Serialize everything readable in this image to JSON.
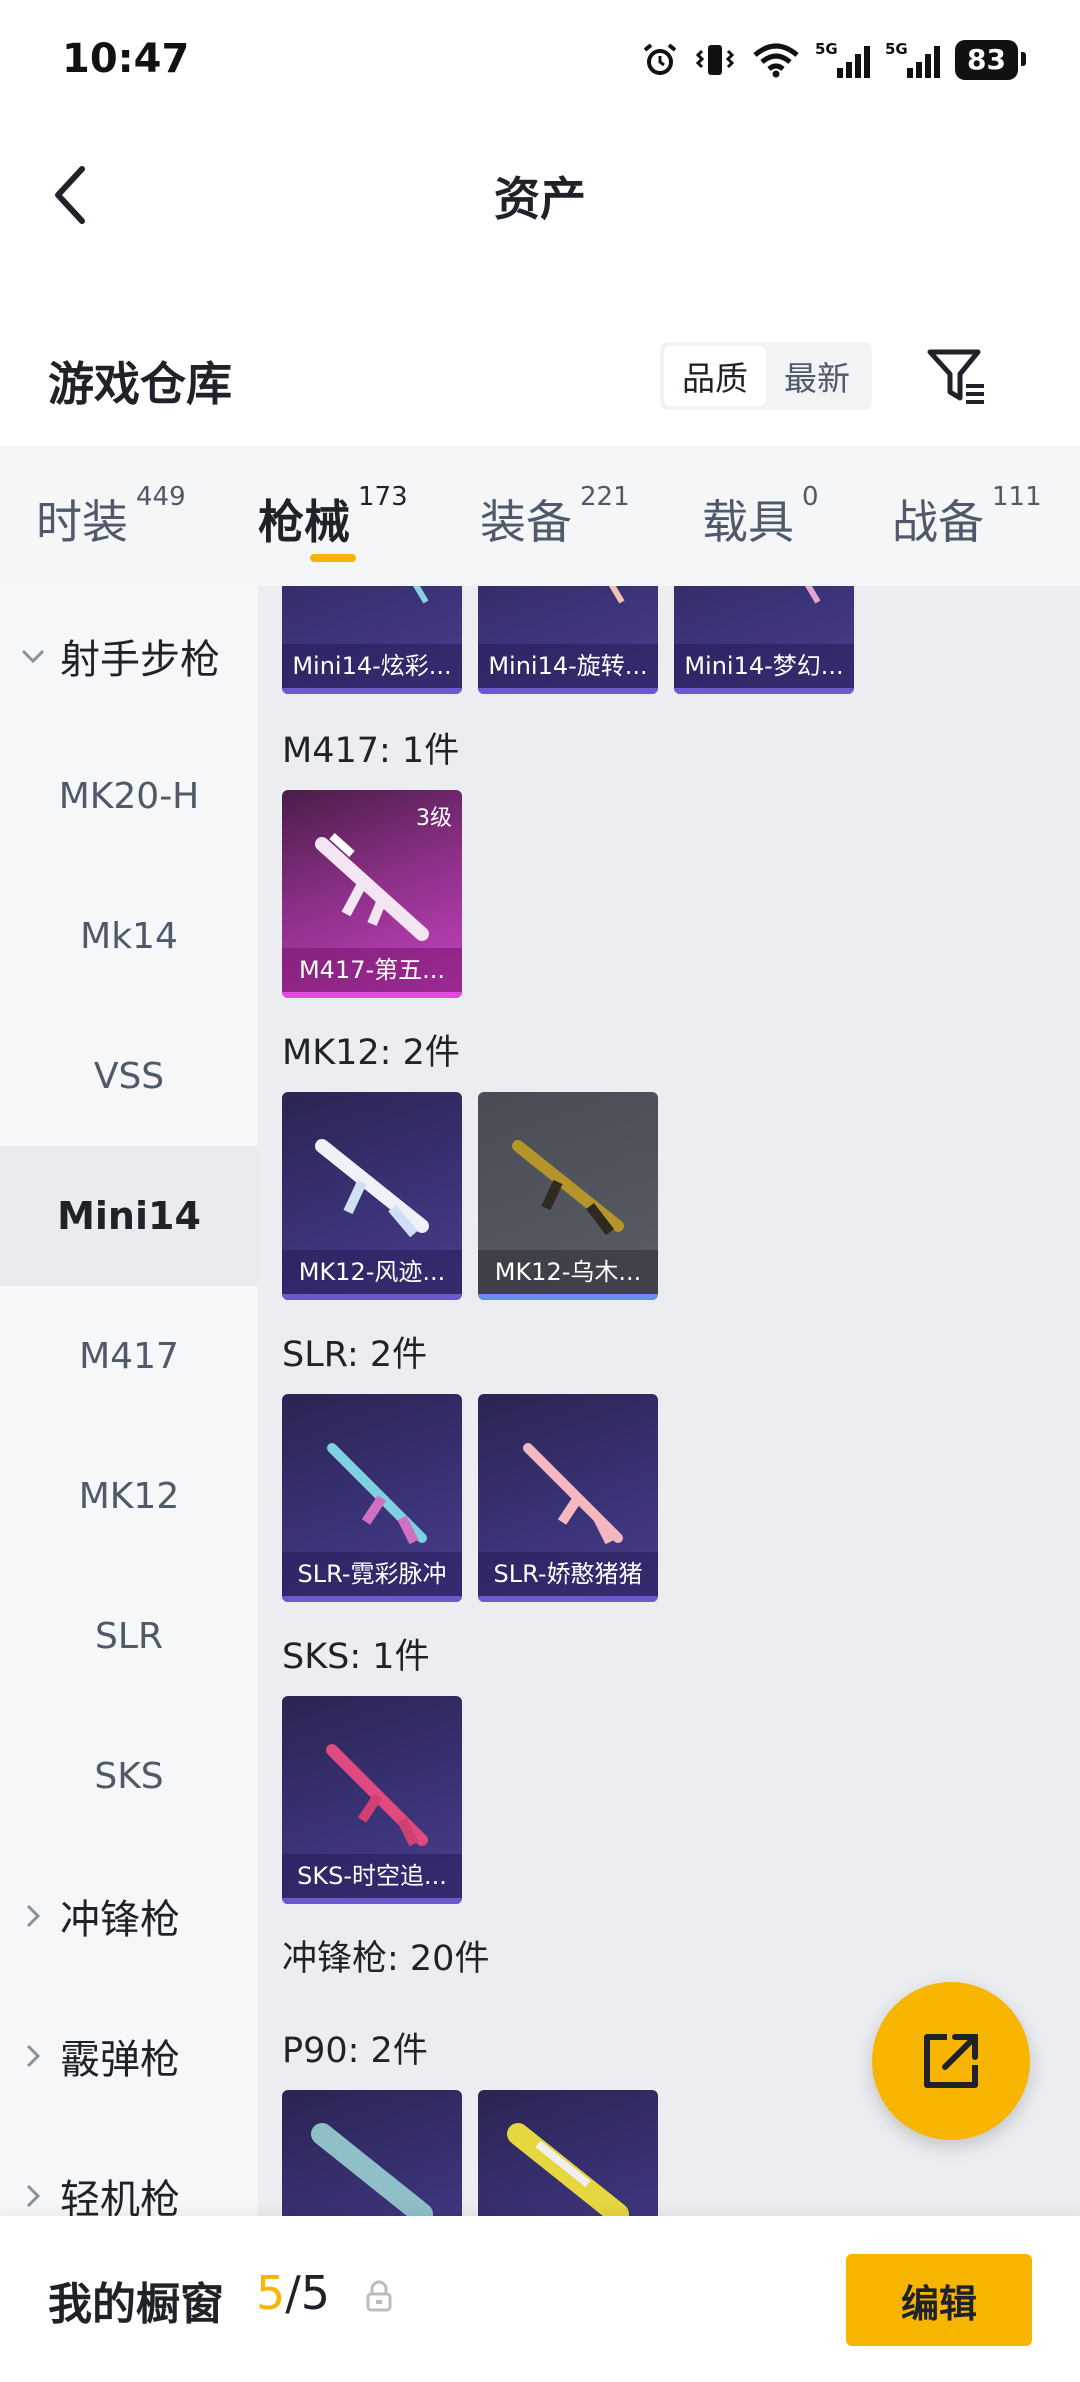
{
  "status_bar": {
    "time": "10:47",
    "battery": "83"
  },
  "header": {
    "title": "资产"
  },
  "warehouse": {
    "title": "游戏仓库",
    "sort_options": [
      "品质",
      "最新"
    ],
    "active_sort": "品质"
  },
  "tabs": [
    {
      "label": "时装",
      "count": "449"
    },
    {
      "label": "枪械",
      "count": "173"
    },
    {
      "label": "装备",
      "count": "221"
    },
    {
      "label": "载具",
      "count": "0"
    },
    {
      "label": "战备",
      "count": "111"
    }
  ],
  "active_tab": "枪械",
  "sidebar": {
    "items": [
      {
        "label": "射手步枪",
        "type": "group",
        "expanded": true
      },
      {
        "label": "MK20-H",
        "type": "item"
      },
      {
        "label": "Mk14",
        "type": "item"
      },
      {
        "label": "VSS",
        "type": "item"
      },
      {
        "label": "Mini14",
        "type": "item",
        "active": true
      },
      {
        "label": "M417",
        "type": "item"
      },
      {
        "label": "MK12",
        "type": "item"
      },
      {
        "label": "SLR",
        "type": "item"
      },
      {
        "label": "SKS",
        "type": "item"
      },
      {
        "label": "冲锋枪",
        "type": "group",
        "expanded": false
      },
      {
        "label": "霰弹枪",
        "type": "group",
        "expanded": false
      },
      {
        "label": "轻机枪",
        "type": "group",
        "expanded": false
      }
    ]
  },
  "content": {
    "top_cards": [
      "Mini14-炫彩...",
      "Mini14-旋转...",
      "Mini14-梦幻..."
    ],
    "sections": [
      {
        "label": "M417: 1件",
        "cards": [
          {
            "name": "M417-第五...",
            "level": "3级"
          }
        ]
      },
      {
        "label": "MK12: 2件",
        "cards": [
          {
            "name": "MK12-风迹..."
          },
          {
            "name": "MK12-乌木..."
          }
        ]
      },
      {
        "label": "SLR: 2件",
        "cards": [
          {
            "name": "SLR-霓彩脉冲"
          },
          {
            "name": "SLR-娇憨猪猪"
          }
        ]
      },
      {
        "label": "SKS: 1件",
        "cards": [
          {
            "name": "SKS-时空追..."
          }
        ]
      }
    ],
    "group_label": "冲锋枪: 20件",
    "p90_label": "P90: 2件"
  },
  "bottom_bar": {
    "label": "我的橱窗",
    "count_current": "5",
    "count_sep": "/",
    "count_total": "5",
    "edit_label": "编辑"
  },
  "colors": {
    "accent": "#f7b500"
  }
}
